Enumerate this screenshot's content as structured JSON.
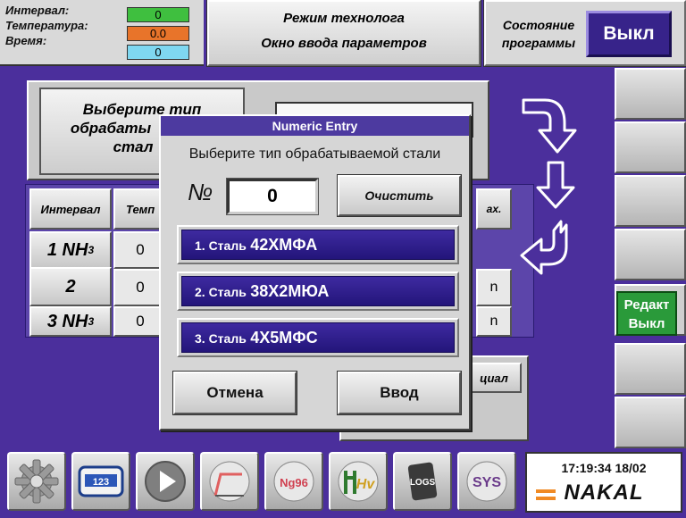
{
  "header": {
    "interval_label": "Интервал:",
    "temperature_label": "Температура:",
    "time_label": "Время:",
    "interval_value": "0",
    "temperature_value": "0.0",
    "time_value": "0",
    "mode_line1": "Режим технолога",
    "mode_line2": "Окно ввода параметров",
    "state_line1": "Состояние",
    "state_line2": "программы",
    "state_button": "Выкл",
    "colors": {
      "interval": "#3fbf3f",
      "temperature": "#e8742a",
      "time": "#7fd7f0"
    }
  },
  "background": {
    "select_line1": "Выберите тип",
    "select_line2": "обрабаты",
    "select_line3": "стал",
    "col_interval": "Интервал",
    "col_temp": "Темп",
    "col_max": "ах.",
    "rows": [
      {
        "name": "1 NH",
        "sub": "3",
        "val": "0",
        "tail": ""
      },
      {
        "name": "2",
        "sub": "",
        "val": "0",
        "tail": "n"
      },
      {
        "name": "3 NH",
        "sub": "3",
        "val": "0",
        "tail": "n"
      }
    ],
    "special": "циал"
  },
  "dialog": {
    "title": "Numeric Entry",
    "prompt": "Выберите тип обрабатываемой стали",
    "number_label": "№",
    "number_value": "0",
    "clear_button": "Очистить",
    "options": [
      {
        "prefix": "1. Сталь",
        "grade": "42ХМФА"
      },
      {
        "prefix": "2. Сталь",
        "grade": "38Х2МЮА"
      },
      {
        "prefix": "3. Сталь",
        "grade": "4Х5МФС"
      }
    ],
    "cancel_button": "Отмена",
    "enter_button": "Ввод"
  },
  "side": {
    "edit_line1": "Редакт",
    "edit_line2": "Выкл"
  },
  "footer": {
    "clock": "17:19:34 18/02",
    "logo": "NAKAL",
    "icons": [
      "gear-icon",
      "counter-icon",
      "play-icon",
      "curve-icon",
      "nitriding-icon",
      "hardness-icon",
      "logs-icon",
      "system-icon"
    ],
    "counter_text": "123",
    "logs_text": "LOGS",
    "sys_text": "SYS",
    "hv_text": "Hv",
    "nitr_text": "Ng96"
  }
}
